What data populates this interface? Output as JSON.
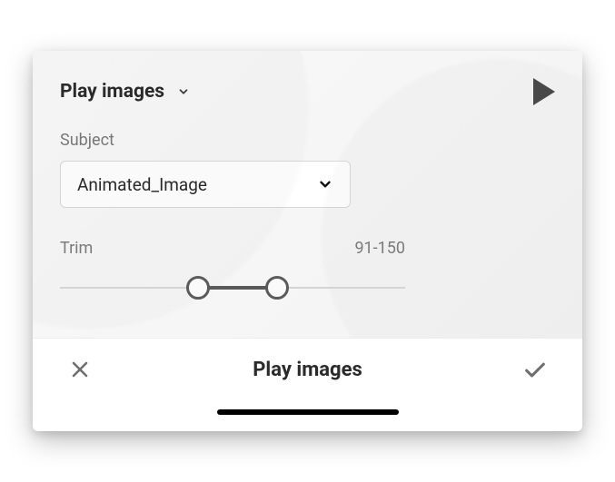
{
  "header": {
    "title": "Play images"
  },
  "subject": {
    "label": "Subject",
    "selected": "Animated_Image"
  },
  "trim": {
    "label": "Trim",
    "rangeText": "91-150",
    "min": 0,
    "max": 200,
    "low": 91,
    "high": 150,
    "lowPercent": 40,
    "highPercent": 63
  },
  "footer": {
    "title": "Play images"
  }
}
